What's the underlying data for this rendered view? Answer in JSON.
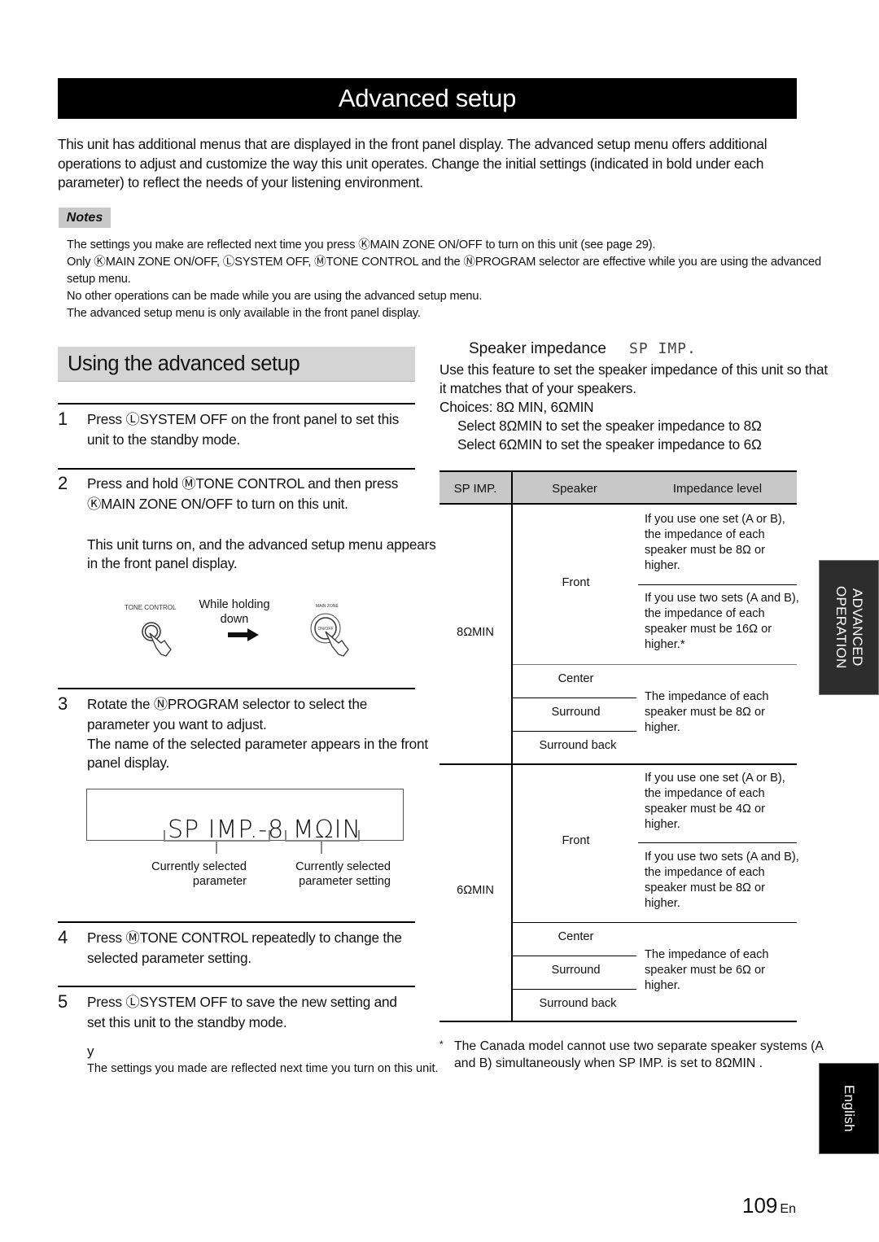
{
  "page": {
    "title": "Advanced setup",
    "intro": "This unit has additional menus that are displayed in the front panel display. The advanced setup menu offers additional operations to adjust and customize the way this unit operates. Change the initial settings (indicated in bold under each parameter) to reflect the needs of your listening environment.",
    "page_number": "109",
    "page_lang_suffix": "En"
  },
  "notes": {
    "label": "Notes",
    "items": [
      "The settings you make are reflected next time you press ⓀMAIN ZONE ON/OFF to turn on this unit (see page 29).",
      "Only ⓀMAIN ZONE ON/OFF, ⓁSYSTEM OFF, ⓂTONE CONTROL and the ⓃPROGRAM selector are effective while you are using the advanced setup menu.",
      "No other operations can be made while you are using the advanced setup menu.",
      "The advanced setup menu is only available in the front panel display."
    ]
  },
  "left": {
    "section_title": "Using the advanced setup",
    "steps": [
      {
        "num": "1",
        "text": "Press ⓁSYSTEM OFF  on the front panel to set this unit to  the standby mode."
      },
      {
        "num": "2",
        "text": "Press and hold  ⓂTONE CONTROL  and then press  ⓀMAIN ZONE ON/OFF  to turn on this unit.",
        "detail": "This unit turns on, and the advanced setup menu appears in the front panel display."
      },
      {
        "num": "3",
        "text": "Rotate the  ⓃPROGRAM  selector to select the parameter you want to adjust.",
        "detail": "The name of the selected parameter appears in the front panel display."
      },
      {
        "num": "4",
        "text": "Press ⓂTONE CONTROL  repeatedly to change the selected parameter setting."
      },
      {
        "num": "5",
        "text": "Press ⓁSYSTEM OFF  to save the new setting and set this unit to the standby mode."
      }
    ],
    "illustration": {
      "tone_control_label": "TONE CONTROL",
      "hold_label": "While holding down",
      "main_zone_label": "MAIN ZONE",
      "on_off_label": "ON/OFF",
      "arrow_icon": "right-arrow"
    },
    "display": {
      "text": "SP IMP.-8 MΩIN",
      "callout_param": "Currently selected parameter",
      "callout_setting": "Currently selected parameter setting"
    },
    "tip_marker": "y",
    "tip_text": "The settings you made are reflected next time you turn on this unit."
  },
  "right": {
    "subsection_title": "Speaker impedance",
    "subsection_lcd": "SP IMP.",
    "description": "Use this feature to set the speaker impedance of this unit so that it matches that of your speakers.",
    "choices": "Choices: 8Ω MIN, 6ΩMIN",
    "select_lines": [
      "Select  8ΩMIN  to set the speaker impedance to 8Ω",
      "Select  6ΩMIN  to set the speaker impedance to 6Ω"
    ],
    "table": {
      "headers": [
        "SP IMP.",
        "Speaker",
        "Impedance level"
      ],
      "groups": [
        {
          "setting": "8ΩMIN",
          "front": "Front",
          "front_one_set": "If you use one set (A or B), the impedance of each speaker must be 8Ω or higher.",
          "front_two_sets": "If you use two sets (A and B), the impedance of each speaker must be 16Ω or higher.*",
          "others": [
            "Center",
            "Surround",
            "Surround back"
          ],
          "others_level": "The impedance of each speaker must be 8Ω or higher."
        },
        {
          "setting": "6ΩMIN",
          "front": "Front",
          "front_one_set": "If you use one set (A or B), the impedance of each speaker must be 4Ω or higher.",
          "front_two_sets": "If you use two sets (A and B), the impedance of each speaker must be 8Ω or higher.",
          "others": [
            "Center",
            "Surround",
            "Surround back"
          ],
          "others_level": "The impedance of each speaker must be 6Ω or higher."
        }
      ]
    },
    "footnote_marker": "*",
    "footnote": "The Canada model cannot use two separate speaker systems (A and B) simultaneously when  SP IMP.  is set to 8ΩMIN ."
  },
  "side_tabs": {
    "advanced_operation": "ADVANCED OPERATION",
    "language": "English"
  },
  "colors": {
    "title_bg": "#000000",
    "section_bg": "#d4d4d4",
    "table_header_bg": "#c8c8c8",
    "side_tab_bg": "#2d2d2d"
  }
}
